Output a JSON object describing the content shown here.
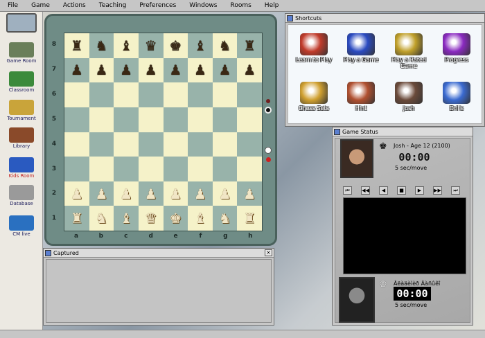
{
  "menu": [
    "File",
    "Game",
    "Actions",
    "Teaching",
    "Preferences",
    "Windows",
    "Rooms",
    "Help"
  ],
  "sidebar": [
    {
      "label": "Game Room",
      "icon": "chessboard-icon",
      "color": "#6a7f5a"
    },
    {
      "label": "Classroom",
      "icon": "chalkboard-icon",
      "color": "#3b8a3b"
    },
    {
      "label": "Tournament",
      "icon": "trophy-icon",
      "color": "#c9a43a"
    },
    {
      "label": "Library",
      "icon": "books-icon",
      "color": "#8a4a2a"
    },
    {
      "label": "Kids Room",
      "icon": "kids-room-icon",
      "color": "#2a5ac0"
    },
    {
      "label": "Database",
      "icon": "database-icon",
      "color": "#9a9a9a"
    },
    {
      "label": "CM live",
      "icon": "globe-icon",
      "color": "#2a70c0"
    }
  ],
  "board": {
    "ranks": [
      "8",
      "7",
      "6",
      "5",
      "4",
      "3",
      "2",
      "1"
    ],
    "files": [
      "a",
      "b",
      "c",
      "d",
      "e",
      "f",
      "g",
      "h"
    ],
    "rows": [
      [
        "bR",
        "bN",
        "bB",
        "bQ",
        "bK",
        "bB",
        "bN",
        "bR"
      ],
      [
        "bP",
        "bP",
        "bP",
        "bP",
        "bP",
        "bP",
        "bP",
        "bP"
      ],
      [
        "",
        "",
        "",
        "",
        "",
        "",
        "",
        ""
      ],
      [
        "",
        "",
        "",
        "",
        "",
        "",
        "",
        ""
      ],
      [
        "",
        "",
        "",
        "",
        "",
        "",
        "",
        ""
      ],
      [
        "",
        "",
        "",
        "",
        "",
        "",
        "",
        ""
      ],
      [
        "wP",
        "wP",
        "wP",
        "wP",
        "wP",
        "wP",
        "wP",
        "wP"
      ],
      [
        "wR",
        "wN",
        "wB",
        "wQ",
        "wK",
        "wB",
        "wN",
        "wR"
      ]
    ],
    "glyphs": {
      "K": "♚",
      "Q": "♛",
      "R": "♜",
      "B": "♝",
      "N": "♞",
      "P": "♟"
    }
  },
  "shortcuts": {
    "title": "Shortcuts",
    "items": [
      {
        "label": "Learn to Play",
        "icon": "learn-icon",
        "color": "#c03a2a"
      },
      {
        "label": "Play a Game",
        "icon": "play-icon",
        "color": "#2a4ac0"
      },
      {
        "label": "Play a Rated Game",
        "icon": "rated-game-icon",
        "color": "#c0a02a"
      },
      {
        "label": "Progress",
        "icon": "progress-icon",
        "color": "#8a2ac0"
      },
      {
        "label": "Chess Sets",
        "icon": "chess-sets-icon",
        "color": "#d0a030"
      },
      {
        "label": "Hint",
        "icon": "hint-icon",
        "color": "#b05030"
      },
      {
        "label": "Josh",
        "icon": "josh-icon",
        "color": "#6a4a3a"
      },
      {
        "label": "Drills",
        "icon": "drills-icon",
        "color": "#3a6ad0"
      }
    ]
  },
  "status": {
    "title": "Game Status",
    "top_player": {
      "name": "Josh - Age 12 (2100)",
      "clock": "00:00",
      "increment": "5   sec/move"
    },
    "bottom_player": {
      "name": "Âëàäèìèð Âàñûêî",
      "clock": "00:00",
      "increment": "5   sec/move"
    },
    "nav": [
      "⏮",
      "◀◀",
      "◀",
      "■",
      "▶",
      "▶▶",
      "⏭"
    ]
  },
  "captured": {
    "title": "Captured"
  },
  "colors": {
    "light_square": "#f5f2c9",
    "dark_square": "#98b3aa",
    "frame": "#6f8c86"
  }
}
